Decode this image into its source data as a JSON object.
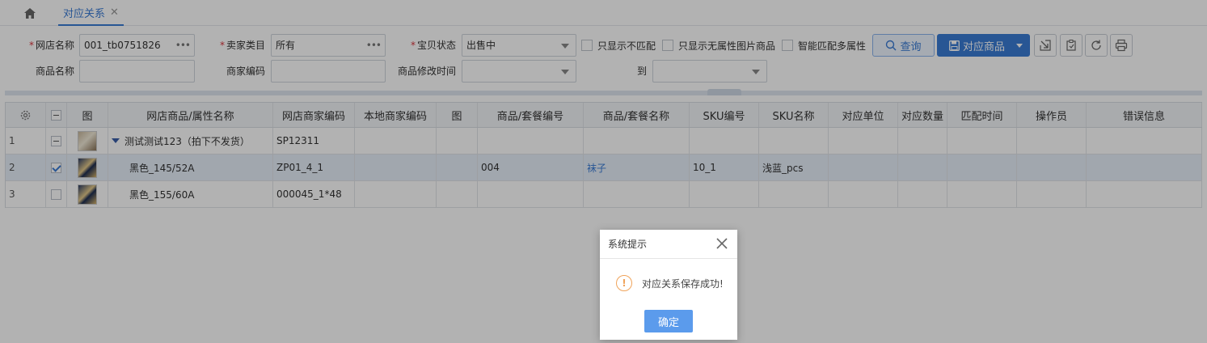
{
  "tabs": {
    "active_label": "对应关系",
    "close_glyph": "✕"
  },
  "filters": {
    "shop_name": {
      "label": "网店名称",
      "value": "001_tb0751826",
      "picker": "•••"
    },
    "seller_category": {
      "label": "卖家类目",
      "value": "所有",
      "picker": "•••"
    },
    "item_status": {
      "label": "宝贝状态",
      "value": "出售中"
    },
    "product_name": {
      "label": "商品名称",
      "value": ""
    },
    "merchant_code": {
      "label": "商家编码",
      "value": ""
    },
    "modified_time": {
      "label": "商品修改时间",
      "value": ""
    },
    "to": {
      "label": "到",
      "value": ""
    },
    "checkbox_unmatched": "只显示不匹配",
    "checkbox_no_attr_image": "只显示无属性图片商品",
    "checkbox_smart_match": "智能匹配多属性"
  },
  "toolbar": {
    "query_label": "查询",
    "map_product_label": "对应商品"
  },
  "grid": {
    "columns": [
      "网店商品/属性名称",
      "网店商家编码",
      "本地商家编码",
      "图",
      "商品/套餐编号",
      "商品/套餐名称",
      "SKU编号",
      "SKU名称",
      "对应单位",
      "对应数量",
      "匹配时间",
      "操作员",
      "错误信息"
    ],
    "image_col": "图",
    "rows": [
      {
        "num": "1",
        "name": "测试测试123（拍下不发货）",
        "shop_code": "SP12311",
        "local_code": "",
        "pkg_no": "",
        "pkg_name": "",
        "sku_no": "",
        "sku_name": ""
      },
      {
        "num": "2",
        "name": "黑色_145/52A",
        "shop_code": "ZP01_4_1",
        "local_code": "",
        "pkg_no": "004",
        "pkg_name": "袜子",
        "sku_no": "10_1",
        "sku_name": "浅蓝_pcs"
      },
      {
        "num": "3",
        "name": "黑色_155/60A",
        "shop_code": "000045_1*48",
        "local_code": "",
        "pkg_no": "",
        "pkg_name": "",
        "sku_no": "",
        "sku_name": ""
      }
    ]
  },
  "dialog": {
    "title": "系统提示",
    "message": "对应关系保存成功!",
    "ok_label": "确定",
    "warn_glyph": "!"
  },
  "colors": {
    "accent": "#3a7bd5",
    "required": "#d9363e",
    "warning": "#f0a35a"
  }
}
